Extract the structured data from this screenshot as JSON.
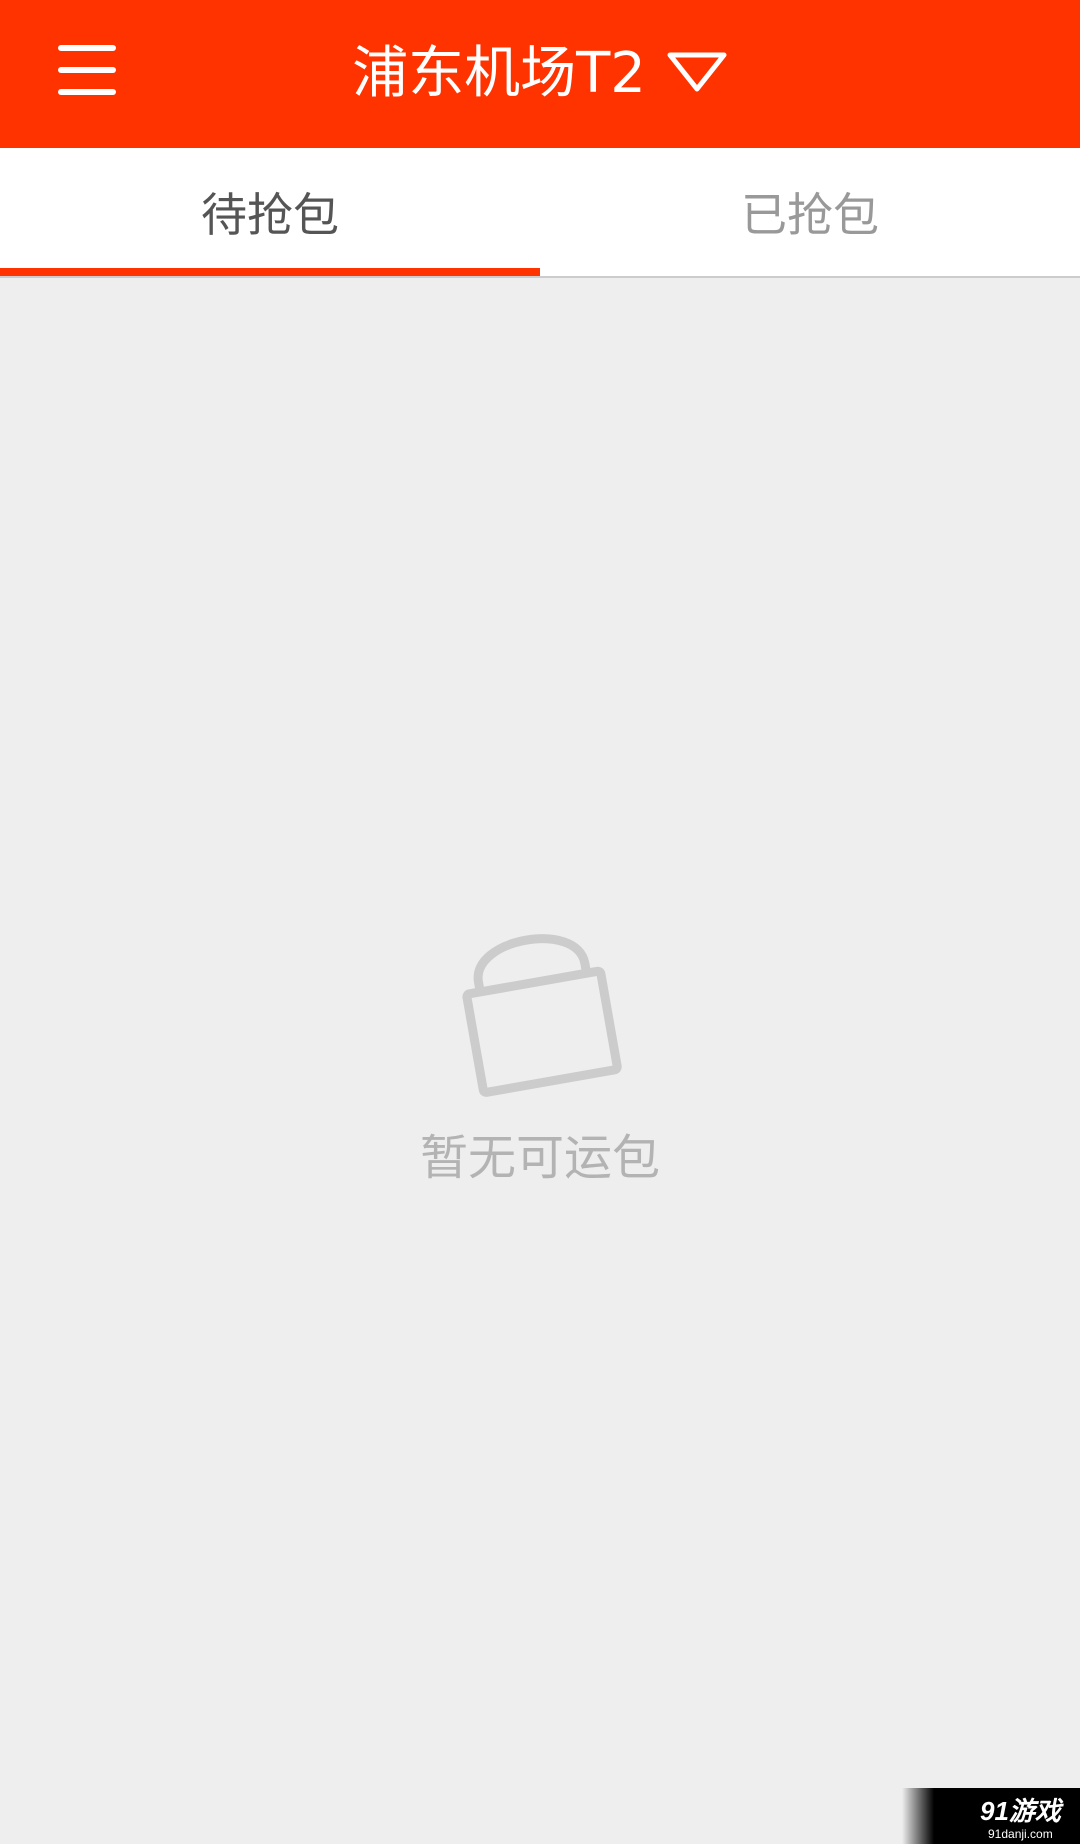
{
  "colors": {
    "accent": "#ff3300",
    "background": "#eeeeee",
    "tab_active_text": "#555555",
    "tab_inactive_text": "#999999",
    "empty_text": "#b3b3b3"
  },
  "app_bar": {
    "menu_icon": "hamburger-menu-icon",
    "title": "浦东机场T2",
    "dropdown_icon": "triangle-down-icon"
  },
  "tabs": [
    {
      "label": "待抢包",
      "active": true
    },
    {
      "label": "已抢包",
      "active": false
    }
  ],
  "empty_state": {
    "icon": "bag-icon",
    "message": "暂无可运包"
  },
  "watermark": {
    "brand": "91游戏",
    "url": "91danji.com"
  }
}
